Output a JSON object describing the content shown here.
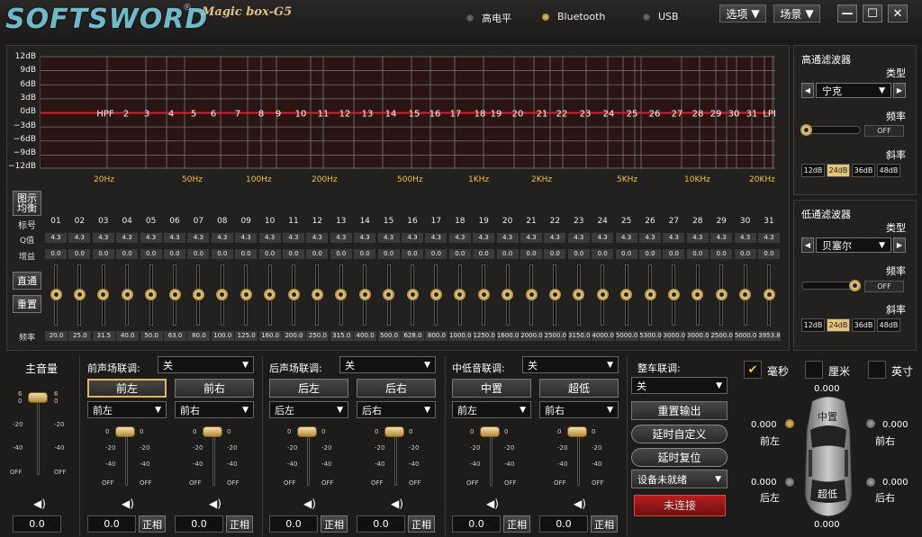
{
  "header": {
    "logo": "SOFTSWORD",
    "logo_mark": "®",
    "model": "Magic box-G5",
    "indicators": [
      {
        "label": "高电平",
        "active": false
      },
      {
        "label": "Bluetooth",
        "active": true
      },
      {
        "label": "USB",
        "active": false
      }
    ],
    "menus": [
      {
        "label": "选项"
      },
      {
        "label": "场景"
      }
    ],
    "win": {
      "min": "—",
      "max": "☐",
      "close": "✕"
    }
  },
  "eq": {
    "y_labels": [
      "12dB",
      "9dB",
      "6dB",
      "3dB",
      "0dB",
      "−3dB",
      "−6dB",
      "−9dB",
      "−12dB"
    ],
    "x_labels": [
      "20Hz",
      "50Hz",
      "100Hz",
      "200Hz",
      "500Hz",
      "1KHz",
      "2KHz",
      "5KHz",
      "10KHz",
      "20KHz"
    ],
    "band_markers": [
      "HPF",
      "2",
      "3",
      "4",
      "5",
      "6",
      "7",
      "8",
      "9",
      "10",
      "11",
      "12",
      "13",
      "14",
      "15",
      "16",
      "17",
      "18",
      "19",
      "20",
      "21",
      "22",
      "23",
      "24",
      "25",
      "26",
      "27",
      "28",
      "29",
      "30",
      "31",
      "LPF"
    ],
    "graphic_eq_btn": "图示\n均衡",
    "row_labels": {
      "ch": "标号",
      "q": "Q值",
      "gain": "增益",
      "freq": "频率"
    },
    "bypass_btn": "直通",
    "reset_btn": "重置",
    "channels": [
      "01",
      "02",
      "03",
      "04",
      "05",
      "06",
      "07",
      "08",
      "09",
      "10",
      "11",
      "12",
      "13",
      "14",
      "15",
      "16",
      "17",
      "18",
      "19",
      "20",
      "21",
      "22",
      "23",
      "24",
      "25",
      "26",
      "27",
      "28",
      "29",
      "30",
      "31"
    ],
    "q": [
      "4.3",
      "4.3",
      "4.3",
      "4.3",
      "4.3",
      "4.3",
      "4.3",
      "4.3",
      "4.3",
      "4.3",
      "4.3",
      "4.3",
      "4.3",
      "4.3",
      "4.3",
      "4.3",
      "4.3",
      "4.3",
      "4.3",
      "4.3",
      "4.3",
      "4.3",
      "4.3",
      "4.3",
      "4.3",
      "4.3",
      "4.3",
      "4.3",
      "4.3",
      "4.3",
      "4.3"
    ],
    "gain": [
      "0.0",
      "0.0",
      "0.0",
      "0.0",
      "0.0",
      "0.0",
      "0.0",
      "0.0",
      "0.0",
      "0.0",
      "0.0",
      "0.0",
      "0.0",
      "0.0",
      "0.0",
      "0.0",
      "0.0",
      "0.0",
      "0.0",
      "0.0",
      "0.0",
      "0.0",
      "0.0",
      "0.0",
      "0.0",
      "0.0",
      "0.0",
      "0.0",
      "0.0",
      "0.0",
      "0.0"
    ],
    "freq": [
      "20.0",
      "25.0",
      "31.5",
      "40.0",
      "50.0",
      "63.0",
      "80.0",
      "100.0",
      "125.0",
      "160.0",
      "200.0",
      "250.0",
      "315.0",
      "400.0",
      "500.0",
      "628.0",
      "800.0",
      "1000.0",
      "1250.0",
      "1600.0",
      "2000.0",
      "2500.0",
      "3150.0",
      "4000.0",
      "5000.0",
      "5300.0",
      "3000.0",
      "3000.0",
      "2500.0",
      "5000.0",
      "3953.8"
    ]
  },
  "hpf": {
    "title": "高通滤波器",
    "type_label": "类型",
    "type": "宁克",
    "freq_label": "频率",
    "freq_value": "OFF",
    "slope_label": "斜率",
    "slopes": [
      "12dB",
      "24dB",
      "36dB",
      "48dB"
    ],
    "slope_active": 1
  },
  "lpf": {
    "title": "低通滤波器",
    "type_label": "类型",
    "type": "贝塞尔",
    "freq_label": "频率",
    "freq_value": "OFF",
    "slope_label": "斜率",
    "slopes": [
      "12dB",
      "24dB",
      "36dB",
      "48dB"
    ],
    "slope_active": 1
  },
  "master": {
    "label": "主音量",
    "value": "0.0",
    "scale": [
      "6",
      "0",
      "-20",
      "-40",
      "OFF"
    ]
  },
  "groups": [
    {
      "link_label": "前声场联调:",
      "link_value": "关",
      "channels": [
        {
          "name": "前左",
          "src": "前左",
          "value": "0.0",
          "phase": "正相",
          "active": true
        },
        {
          "name": "前右",
          "src": "前右",
          "value": "0.0",
          "phase": "正相",
          "active": false
        }
      ]
    },
    {
      "link_label": "后声场联调:",
      "link_value": "关",
      "channels": [
        {
          "name": "后左",
          "src": "后左",
          "value": "0.0",
          "phase": "正相",
          "active": false
        },
        {
          "name": "后右",
          "src": "后右",
          "value": "0.0",
          "phase": "正相",
          "active": false
        }
      ]
    },
    {
      "link_label": "中低音联调:",
      "link_value": "关",
      "channels": [
        {
          "name": "中置",
          "src": "前左",
          "value": "0.0",
          "phase": "正相",
          "active": false
        },
        {
          "name": "超低",
          "src": "前右",
          "value": "0.0",
          "phase": "正相",
          "active": false
        }
      ]
    }
  ],
  "channel_scale": [
    "0",
    "-20",
    "-40",
    "OFF"
  ],
  "car_link": {
    "label": "整车联调:",
    "value": "关",
    "reset_output": "重置输出",
    "delay_custom": "延时自定义",
    "delay_reset": "延时复位",
    "device_status": "设备未就绪",
    "connect": "未连接"
  },
  "units": [
    {
      "label": "毫秒",
      "checked": true
    },
    {
      "label": "厘米",
      "checked": false
    },
    {
      "label": "英寸",
      "checked": false
    }
  ],
  "car": {
    "center_label": "中置",
    "sub_label": "超低",
    "speakers": {
      "front_left": {
        "label": "前左",
        "value": "0.000"
      },
      "front_right": {
        "label": "前右",
        "value": "0.000"
      },
      "rear_left": {
        "label": "后左",
        "value": "0.000"
      },
      "rear_right": {
        "label": "后右",
        "value": "0.000"
      },
      "center": {
        "value": "0.000"
      },
      "sub": {
        "value": "0.000"
      }
    }
  }
}
